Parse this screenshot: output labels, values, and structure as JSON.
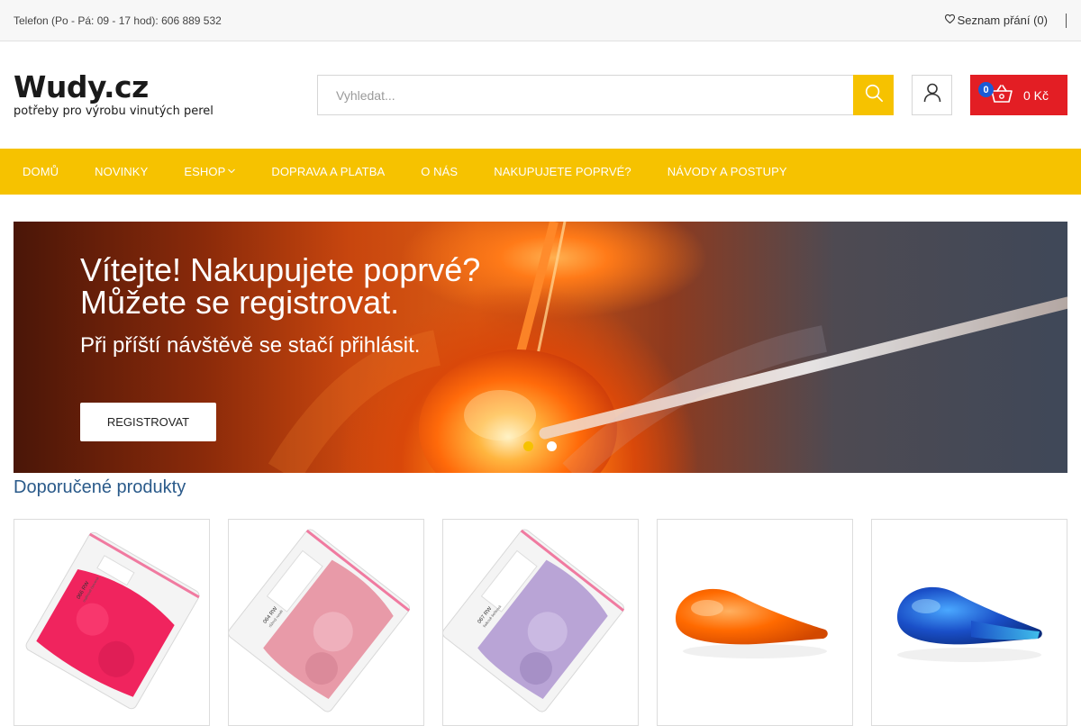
{
  "topbar": {
    "phone_text": "Telefon (Po - Pá: 09 - 17 hod): 606 889 532",
    "wishlist_label": "Seznam přání (0)",
    "wishlist_icon": "heart-icon"
  },
  "header": {
    "logo_name": "Wudy.cz",
    "logo_tagline": "potřeby pro výrobu vinutých perel",
    "search_placeholder": "Vyhledat...",
    "search_icon": "search-icon",
    "account_icon": "user-icon",
    "cart_badge": "0",
    "cart_total": "0 Kč",
    "cart_icon": "basket-icon"
  },
  "nav": {
    "items": [
      {
        "label": "DOMŮ"
      },
      {
        "label": "NOVINKY"
      },
      {
        "label": "ESHOP"
      },
      {
        "label": "DOPRAVA A PLATBA"
      },
      {
        "label": "O NÁS"
      },
      {
        "label": "NAKUPUJETE POPRVÉ?"
      },
      {
        "label": "NÁVODY A POSTUPY"
      }
    ]
  },
  "hero": {
    "title_line1": "Vítejte! Nakupujete poprvé?",
    "title_line2": "Můžete se registrovat.",
    "subtitle": "Při příští návštěvě se stačí přihlásit.",
    "cta_label": "REGISTROVAT",
    "slide_count": 2,
    "active_slide": 1
  },
  "recommended": {
    "title": "Doporučené produkty",
    "products": [
      {
        "label_on_bag": "066 RW",
        "label_sub": "malinově červená",
        "color": "#f0245e"
      },
      {
        "label_on_bag": "064 RW",
        "label_sub": "růžový ruměl",
        "color": "#e89aa8"
      },
      {
        "label_on_bag": "067 RW",
        "label_sub": "fialkově šeříková",
        "color": "#b9a4d6"
      },
      {
        "color": "#ff6a00"
      },
      {
        "color": "#1f6fd8"
      }
    ]
  },
  "colors": {
    "accent": "#f6c200",
    "cart": "#e31e24",
    "badge": "#1a5bd6",
    "heading": "#2a5a8a"
  }
}
